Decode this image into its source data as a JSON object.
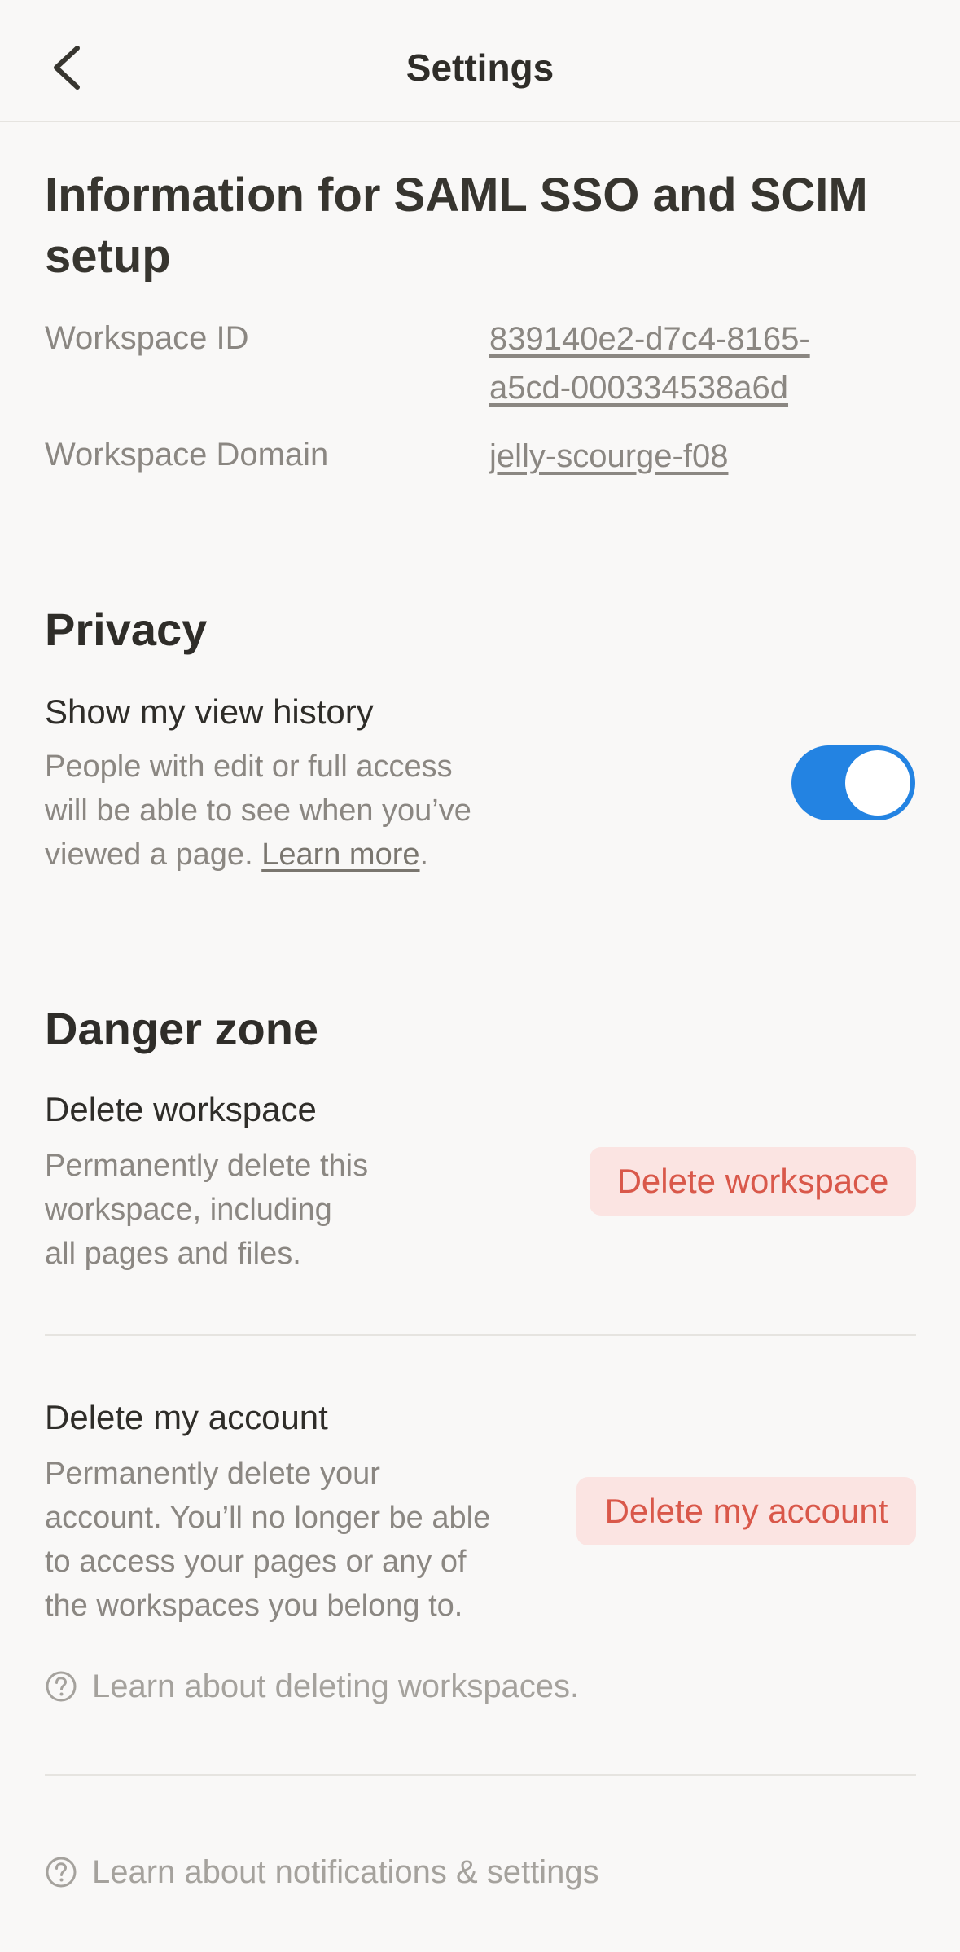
{
  "header": {
    "title": "Settings"
  },
  "saml": {
    "heading": "Information for SAML SSO and SCIM setup",
    "workspace_id_label": "Workspace ID",
    "workspace_id_value_line1": "839140e2-d7c4-8165-",
    "workspace_id_value_line2": "a5cd-000334538a6d",
    "workspace_domain_label": "Workspace Domain",
    "workspace_domain_value": "jelly-scourge-f08"
  },
  "privacy": {
    "heading": "Privacy",
    "view_history_title": "Show my view history",
    "view_history_desc_line1": "People with edit or full access",
    "view_history_desc_line2": "will be able to see when you’ve",
    "view_history_desc_line3_prefix": "viewed a page. ",
    "learn_more": "Learn more",
    "period": ".",
    "toggle_on": true,
    "toggle_color": "#2383e2"
  },
  "danger": {
    "heading": "Danger zone",
    "delete_workspace_title": "Delete workspace",
    "delete_workspace_desc_line1": "Permanently delete this",
    "delete_workspace_desc_line2": "workspace, including",
    "delete_workspace_desc_line3": "all pages and files.",
    "delete_workspace_button": "Delete workspace",
    "delete_account_title": "Delete my account",
    "delete_account_desc_line1": "Permanently delete your",
    "delete_account_desc_line2": "account. You’ll no longer be able",
    "delete_account_desc_line3": "to access your pages or any of",
    "delete_account_desc_line4": "the workspaces you belong to.",
    "delete_account_button": "Delete my account",
    "danger_color": "#d9584a",
    "help_deleting": "Learn about deleting workspaces."
  },
  "footer": {
    "help_notifications": "Learn about notifications & settings"
  },
  "icons": {
    "back": "chevron-left-icon",
    "help": "question-circle-icon"
  }
}
